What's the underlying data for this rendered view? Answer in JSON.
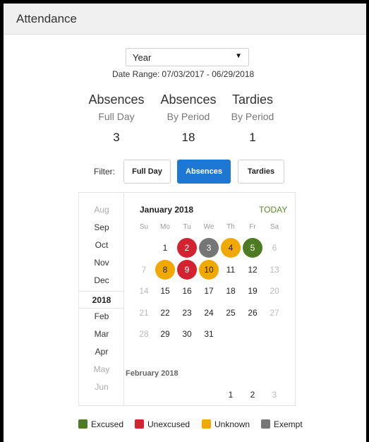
{
  "header": {
    "title": "Attendance"
  },
  "range_select": {
    "value": "Year"
  },
  "date_range": {
    "label": "Date Range:",
    "value": "07/03/2017 - 06/29/2018"
  },
  "stats": [
    {
      "title": "Absences",
      "subtitle": "Full Day",
      "value": "3"
    },
    {
      "title": "Absences",
      "subtitle": "By Period",
      "value": "18"
    },
    {
      "title": "Tardies",
      "subtitle": "By Period",
      "value": "1"
    }
  ],
  "filter": {
    "label": "Filter:",
    "buttons": [
      {
        "label": "Full Day",
        "active": false
      },
      {
        "label": "Absences",
        "active": true
      },
      {
        "label": "Tardies",
        "active": false
      }
    ]
  },
  "months": [
    "Aug",
    "Sep",
    "Oct",
    "Nov",
    "Dec",
    "2018",
    "Feb",
    "Mar",
    "Apr",
    "May",
    "Jun"
  ],
  "calendar": {
    "title": "January 2018",
    "today_label": "TODAY",
    "weekdays": [
      "Su",
      "Mo",
      "Tu",
      "We",
      "Th",
      "Fr",
      "Sa"
    ],
    "weeks": [
      [
        "",
        "1",
        "2",
        "3",
        "4",
        "5",
        "6"
      ],
      [
        "7",
        "8",
        "9",
        "10",
        "11",
        "12",
        "13"
      ],
      [
        "14",
        "15",
        "16",
        "17",
        "18",
        "19",
        "20"
      ],
      [
        "21",
        "22",
        "23",
        "24",
        "25",
        "26",
        "27"
      ],
      [
        "28",
        "29",
        "30",
        "31",
        "",
        "",
        ""
      ]
    ],
    "marked_days": {
      "2": "unexcused",
      "3": "exempt",
      "4": "unknown",
      "5": "excused",
      "8": "unknown",
      "9": "unexcused",
      "10": "unknown"
    },
    "next_month_title": "February 2018",
    "next_month_days": [
      "1",
      "2",
      "3"
    ]
  },
  "legend": [
    {
      "label": "Excused",
      "key": "excused"
    },
    {
      "label": "Unexcused",
      "key": "unexcused"
    },
    {
      "label": "Unknown",
      "key": "unknown"
    },
    {
      "label": "Exempt",
      "key": "exempt"
    }
  ],
  "colors": {
    "excused": "#4e7a22",
    "unexcused": "#d32330",
    "unknown": "#f1a800",
    "exempt": "#767676",
    "accent": "#1e78d3"
  }
}
